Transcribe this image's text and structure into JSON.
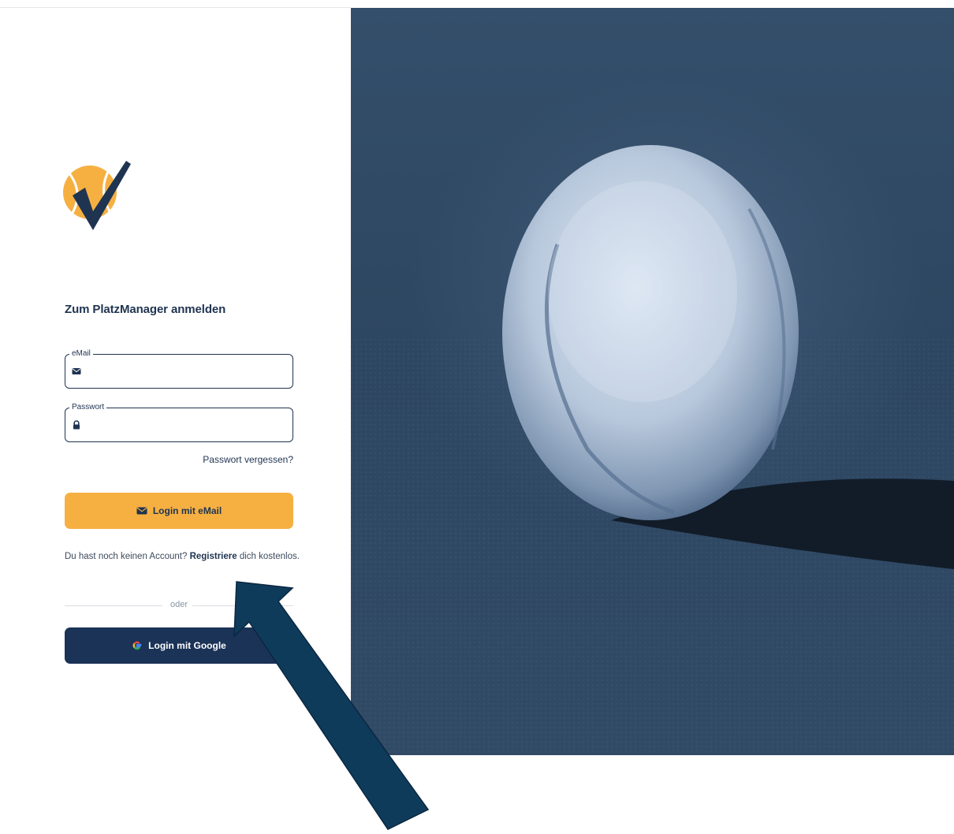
{
  "login": {
    "title": "Zum PlatzManager anmelden",
    "email_legend": "eMail",
    "email_value": "",
    "password_legend": "Passwort",
    "password_value": "",
    "forgot_link": "Passwort vergessen?",
    "email_button_label": "Login mit eMail",
    "register_prefix": "Du hast noch keinen Account? ",
    "register_link": "Registriere",
    "register_suffix": " dich kostenlos.",
    "divider_label": "oder",
    "google_button_label": "Login mit Google"
  },
  "icons": {
    "logo": "tennis-ball-checkmark-logo",
    "email_field": "envelope-icon",
    "password_field": "lock-icon",
    "email_button": "envelope-icon",
    "google_button": "google-g-icon"
  },
  "colors": {
    "brand_navy": "#1f3450",
    "accent_orange": "#f6b042",
    "google_button": "#1a3357",
    "photo_tint": "#2e4763",
    "annotation_arrow": "#0f3b5b"
  }
}
